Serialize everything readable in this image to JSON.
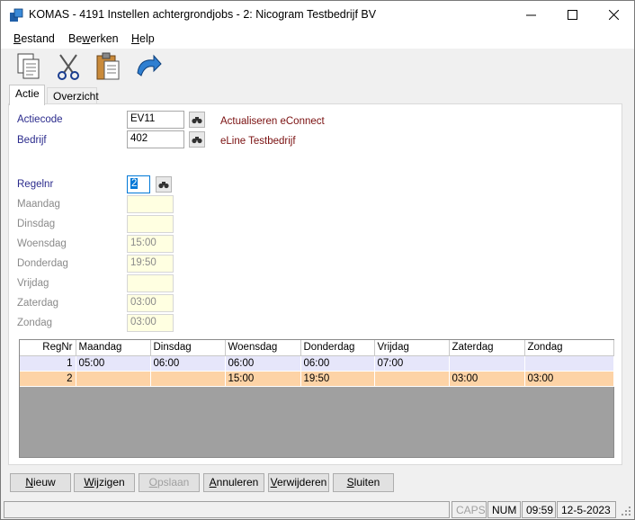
{
  "window": {
    "title": "KOMAS - 4191 Instellen achtergrondjobs - 2: Nicogram Testbedrijf BV"
  },
  "menu": {
    "items": [
      {
        "pre": "",
        "ul": "B",
        "post": "estand"
      },
      {
        "pre": "Be",
        "ul": "w",
        "post": "erken"
      },
      {
        "pre": "",
        "ul": "H",
        "post": "elp"
      }
    ]
  },
  "toolbar": {
    "icons": [
      "copy-icon",
      "scissors-icon",
      "clipboard-icon",
      "undo-icon"
    ]
  },
  "tabs": [
    {
      "label": "Actie"
    },
    {
      "label": "Overzicht"
    }
  ],
  "form": {
    "actiecode": {
      "label": "Actiecode",
      "value": "EV11",
      "description": "Actualiseren eConnect"
    },
    "bedrijf": {
      "label": "Bedrijf",
      "value": "402",
      "description": "eLine Testbedrijf"
    },
    "regelnr": {
      "label": "Regelnr",
      "value": "2"
    },
    "maandag": {
      "label": "Maandag",
      "value": ""
    },
    "dinsdag": {
      "label": "Dinsdag",
      "value": ""
    },
    "woensdag": {
      "label": "Woensdag",
      "value": "15:00"
    },
    "donderdag": {
      "label": "Donderdag",
      "value": "19:50"
    },
    "vrijdag": {
      "label": "Vrijdag",
      "value": ""
    },
    "zaterdag": {
      "label": "Zaterdag",
      "value": "03:00"
    },
    "zondag": {
      "label": "Zondag",
      "value": "03:00"
    }
  },
  "grid": {
    "columns": [
      "RegNr",
      "Maandag",
      "Dinsdag",
      "Woensdag",
      "Donderdag",
      "Vrijdag",
      "Zaterdag",
      "Zondag"
    ],
    "rows": [
      [
        "1",
        "05:00",
        "06:00",
        "06:00",
        "06:00",
        "07:00",
        "",
        ""
      ],
      [
        "2",
        "",
        "",
        "15:00",
        "19:50",
        "",
        "03:00",
        "03:00"
      ]
    ]
  },
  "buttons": {
    "nieuw": {
      "pre": "",
      "ul": "N",
      "post": "ieuw"
    },
    "wijzigen": {
      "pre": "",
      "ul": "W",
      "post": "ijzigen"
    },
    "opslaan": {
      "pre": "",
      "ul": "O",
      "post": "pslaan"
    },
    "annuleren": {
      "pre": "",
      "ul": "A",
      "post": "nnuleren"
    },
    "verwijderen": {
      "pre": "",
      "ul": "V",
      "post": "erwijderen"
    },
    "sluiten": {
      "pre": "",
      "ul": "S",
      "post": "luiten"
    }
  },
  "status": {
    "caps": "CAPS",
    "num": "NUM",
    "time": "09:59",
    "date": "12-5-2023"
  }
}
